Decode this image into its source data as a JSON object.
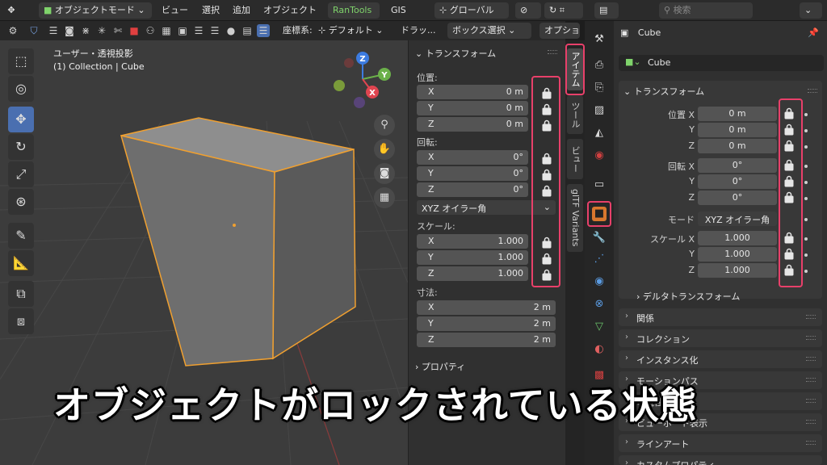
{
  "header": {
    "mode": "オブジェクトモード",
    "menus": [
      "ビュー",
      "選択",
      "追加",
      "オブジェクト"
    ],
    "addon_tab": "RanTools",
    "gis": "GIS",
    "orientation": "グローバル",
    "search_placeholder": "検索"
  },
  "toolbar2": {
    "coord_label": "座標系:",
    "coord_value": "デフォルト",
    "drag_label": "ドラッ...",
    "select_mode": "ボックス選択",
    "options": "オプション"
  },
  "viewport": {
    "view_name": "ユーザー・透視投影",
    "collection": "(1) Collection | Cube",
    "gizmo_axes": [
      "X",
      "Y",
      "Z"
    ]
  },
  "npanel": {
    "transform_header": "トランスフォーム",
    "location_label": "位置:",
    "location": [
      {
        "axis": "X",
        "value": "0 m"
      },
      {
        "axis": "Y",
        "value": "0 m"
      },
      {
        "axis": "Z",
        "value": "0 m"
      }
    ],
    "rotation_label": "回転:",
    "rotation": [
      {
        "axis": "X",
        "value": "0°"
      },
      {
        "axis": "Y",
        "value": "0°"
      },
      {
        "axis": "Z",
        "value": "0°"
      }
    ],
    "rotation_mode": "XYZ オイラー角",
    "scale_label": "スケール:",
    "scale": [
      {
        "axis": "X",
        "value": "1.000"
      },
      {
        "axis": "Y",
        "value": "1.000"
      },
      {
        "axis": "Z",
        "value": "1.000"
      }
    ],
    "dimensions_label": "寸法:",
    "dimensions": [
      {
        "axis": "X",
        "value": "2 m"
      },
      {
        "axis": "Y",
        "value": "2 m"
      },
      {
        "axis": "Z",
        "value": "2 m"
      }
    ],
    "properties_header": "プロパティ"
  },
  "vtabs": [
    "アイテム",
    "ツール",
    "ビュー",
    "glTF Variants"
  ],
  "props": {
    "object_name_top": "Cube",
    "object_name": "Cube",
    "transform_header": "トランスフォーム",
    "location_label": "位置 X",
    "location": [
      "0 m",
      "0 m",
      "0 m"
    ],
    "rotation_label": "回転 X",
    "rotation": [
      "0°",
      "0°",
      "0°"
    ],
    "mode_label": "モード",
    "mode_value": "XYZ オイラー角",
    "scale_label": "スケール X",
    "scale": [
      "1.000",
      "1.000",
      "1.000"
    ],
    "y_label": "Y",
    "z_label": "Z",
    "delta": "デルタトランスフォーム",
    "sections": [
      "関係",
      "コレクション",
      "インスタンス化",
      "モーションパス",
      "可視性",
      "ビューポート表示",
      "ラインアート",
      "カスタムプロパティ"
    ]
  },
  "caption": "オブジェクトがロックされている状態",
  "colors": {
    "highlight": "#e8406a",
    "selection_outline": "#f0a030",
    "accent_blue": "#4a6fb0"
  }
}
